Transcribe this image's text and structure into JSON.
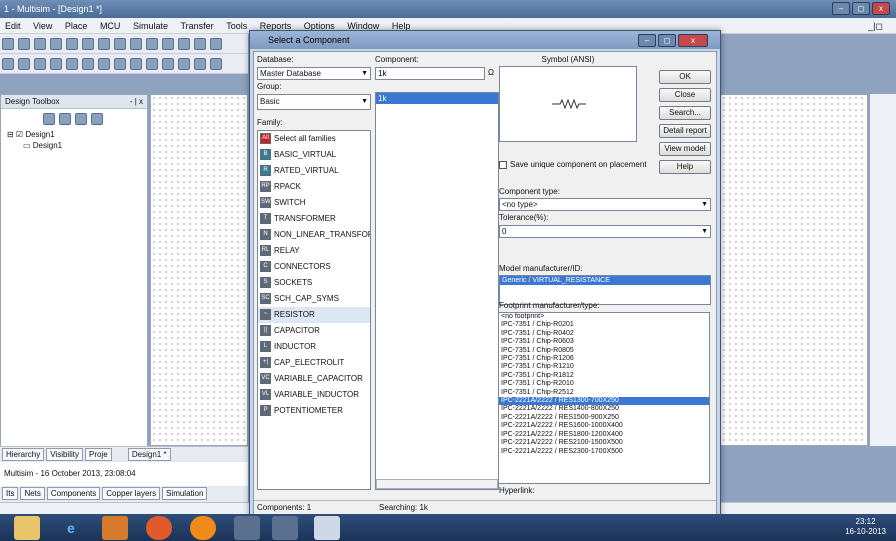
{
  "app": {
    "title": "1 - Multisim - [Design1 *]",
    "window_controls": [
      "–",
      "◻",
      "x"
    ],
    "menu": [
      "Edit",
      "View",
      "Place",
      "MCU",
      "Simulate",
      "Transfer",
      "Tools",
      "Reports",
      "Options",
      "Window",
      "Help"
    ],
    "doc_controls": "_|◻"
  },
  "toolbox": {
    "title": "Design Toolbox",
    "close": "- | x",
    "tree": {
      "root": "Design1",
      "child": "Design1"
    },
    "tabs": [
      "Hierarchy",
      "Visibility",
      "Proje"
    ],
    "doc_tab": "Design1 *"
  },
  "log": {
    "text": "Multisim - 16 October 2013, 23:08:04"
  },
  "log_tabs": [
    "Its",
    "Nets",
    "Components",
    "Copper layers",
    "Simulation"
  ],
  "dialog": {
    "title": "Select a Component",
    "database_label": "Database:",
    "database_value": "Master Database",
    "group_label": "Group:",
    "group_value": "Basic",
    "family_label": "Family:",
    "families": [
      {
        "name": "Select all families",
        "icon": "All",
        "color": "#c0262d"
      },
      {
        "name": "BASIC_VIRTUAL",
        "icon": "B",
        "color": "#2f7f9a"
      },
      {
        "name": "RATED_VIRTUAL",
        "icon": "R",
        "color": "#2f7f9a"
      },
      {
        "name": "RPACK",
        "icon": "RP",
        "color": "#5c6a80"
      },
      {
        "name": "SWITCH",
        "icon": "SW",
        "color": "#5c6a80"
      },
      {
        "name": "TRANSFORMER",
        "icon": "T",
        "color": "#5c6a80"
      },
      {
        "name": "NON_LINEAR_TRANSFOR",
        "icon": "N",
        "color": "#5c6a80"
      },
      {
        "name": "RELAY",
        "icon": "RL",
        "color": "#5c6a80"
      },
      {
        "name": "CONNECTORS",
        "icon": "C",
        "color": "#5c6a80"
      },
      {
        "name": "SOCKETS",
        "icon": "S",
        "color": "#5c6a80"
      },
      {
        "name": "SCH_CAP_SYMS",
        "icon": "SC",
        "color": "#5c6a80"
      },
      {
        "name": "RESISTOR",
        "icon": "~",
        "color": "#5c6a80"
      },
      {
        "name": "CAPACITOR",
        "icon": "||",
        "color": "#5c6a80"
      },
      {
        "name": "INDUCTOR",
        "icon": "L",
        "color": "#5c6a80"
      },
      {
        "name": "CAP_ELECTROLIT",
        "icon": "+|",
        "color": "#5c6a80"
      },
      {
        "name": "VARIABLE_CAPACITOR",
        "icon": "VC",
        "color": "#5c6a80"
      },
      {
        "name": "VARIABLE_INDUCTOR",
        "icon": "VL",
        "color": "#5c6a80"
      },
      {
        "name": "POTENTIOMETER",
        "icon": "P",
        "color": "#5c6a80"
      }
    ],
    "selected_family": "RESISTOR",
    "component_label": "Component:",
    "component_value": "1k",
    "component_list": [
      "1k"
    ],
    "ohm": "Ω",
    "symbol_label": "Symbol (ANSI)",
    "buttons": [
      "OK",
      "Close",
      "Search...",
      "Detail report",
      "View model",
      "Help"
    ],
    "save_unique": "Save unique component on placement",
    "component_type_label": "Component type:",
    "component_type_value": "<no type>",
    "tolerance_label": "Tolerance(%):",
    "tolerance_value": "0",
    "model_label": "Model manufacturer/ID:",
    "model_value": "Generic / VIRTUAL_RESISTANCE",
    "footprint_label": "Footprint manufacturer/type:",
    "footprints": [
      "<no footprint>",
      "IPC-7351 / Chip-R0201",
      "IPC-7351 / Chip-R0402",
      "IPC-7351 / Chip-R0603",
      "IPC-7351 / Chip-R0805",
      "IPC-7351 / Chip-R1206",
      "IPC-7351 / Chip-R1210",
      "IPC-7351 / Chip-R1812",
      "IPC-7351 / Chip-R2010",
      "IPC-7351 / Chip-R2512",
      "IPC-2221A/2222 / RES1300-700X250",
      "IPC-2221A/2222 / RES1400-800X250",
      "IPC-2221A/2222 / RES1500-900X250",
      "IPC-2221A/2222 / RES1600-1000X400",
      "IPC-2221A/2222 / RES1800-1200X400",
      "IPC-2221A/2222 / RES2100-1500X500",
      "IPC-2221A/2222 / RES2300-1700X500"
    ],
    "selected_footprint": "IPC-2221A/2222 / RES1300-700X250",
    "hyperlink_label": "Hyperlink:",
    "status_components": "Components: 1",
    "status_searching": "Searching: 1k"
  },
  "taskbar": {
    "time": "23:12",
    "date": "16-10-2013"
  }
}
